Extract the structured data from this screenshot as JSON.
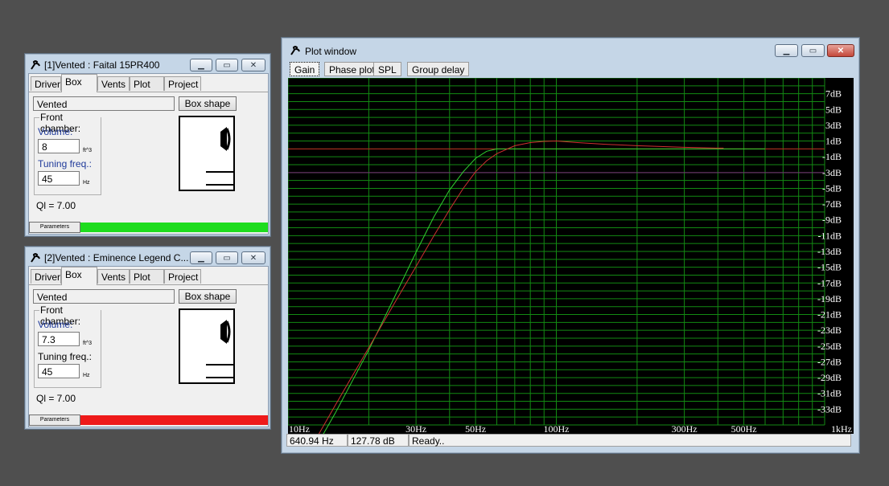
{
  "window1": {
    "title": "[1]Vented : Faital 15PR400",
    "tabs": [
      "Driver",
      "Box",
      "Vents",
      "Plot",
      "Project"
    ],
    "active_tab": "Box",
    "box_type": "Vented",
    "box_shape_button": "Box shape",
    "front_chamber_label": "Front chamber:",
    "volume_label": "Volume:",
    "volume_value": "8",
    "volume_unit": "ft^3",
    "tuning_label": "Tuning freq.:",
    "tuning_value": "45",
    "tuning_unit": "Hz",
    "ql_text": "Ql = 7.00",
    "parameters_button": "Parameters",
    "status_color": "#1edc1e"
  },
  "window2": {
    "title": "[2]Vented : Eminence Legend C...",
    "tabs": [
      "Driver",
      "Box",
      "Vents",
      "Plot",
      "Project"
    ],
    "active_tab": "Box",
    "box_type": "Vented",
    "box_shape_button": "Box shape",
    "front_chamber_label": "Front chamber:",
    "volume_label": "Volume:",
    "volume_value": "7.3",
    "volume_unit": "ft^3",
    "tuning_label": "Tuning freq.:",
    "tuning_value": "45",
    "tuning_unit": "Hz",
    "ql_text": "Ql = 7.00",
    "parameters_button": "Parameters",
    "status_color": "#ee1a1a"
  },
  "plot_window": {
    "title": "Plot window",
    "tabs": [
      "Gain",
      "Phase plot",
      "SPL",
      "Group delay"
    ],
    "active_tab": "Gain",
    "status": {
      "frequency": "640.94 Hz",
      "level": "127.78 dB",
      "message": "Ready.."
    }
  },
  "icons": {
    "app": "speaker-app-icon",
    "minimize": "minimize-icon",
    "maximize": "maximize-icon",
    "close": "close-icon"
  },
  "chart_data": {
    "type": "line",
    "x_scale": "log",
    "xlim": [
      10,
      1000
    ],
    "ylim": [
      -35,
      9
    ],
    "x_tick_labels": [
      "10Hz",
      "30Hz",
      "50Hz",
      "100Hz",
      "300Hz",
      "500Hz",
      "1kHz"
    ],
    "x_ticks": [
      10,
      30,
      50,
      100,
      300,
      500,
      1000
    ],
    "y_ticks": [
      7,
      5,
      3,
      1,
      -1,
      -3,
      -5,
      -7,
      -9,
      -11,
      -13,
      -15,
      -17,
      -19,
      -21,
      -23,
      -25,
      -27,
      -29,
      -31,
      -33
    ],
    "y_tick_suffix": "dB",
    "grid": true,
    "reference_lines": [
      {
        "y": 0,
        "color": "#c02020"
      },
      {
        "y": -3,
        "color": "#7a2a7a"
      }
    ],
    "series": [
      {
        "color": "#30d030",
        "x": [
          10,
          15,
          20,
          25,
          30,
          35,
          40,
          45,
          50,
          55,
          60,
          70,
          80,
          100,
          150,
          200,
          300,
          400,
          500,
          600
        ],
        "y": [
          -44,
          -33.5,
          -25.5,
          -18.7,
          -13.1,
          -8.6,
          -5.2,
          -2.9,
          -1.2,
          -0.3,
          0.0,
          0.0,
          0.0,
          0.0,
          0.0,
          0.0,
          0.0,
          0.0,
          0.0,
          0.0
        ]
      },
      {
        "color": "#d03030",
        "x": [
          10,
          15,
          20,
          25,
          30,
          35,
          40,
          45,
          50,
          55,
          60,
          70,
          80,
          90,
          100,
          120,
          150,
          200,
          300,
          400,
          420
        ],
        "y": [
          -43,
          -32.5,
          -25.2,
          -19.5,
          -14.9,
          -11.0,
          -7.7,
          -5.0,
          -2.9,
          -1.5,
          -0.6,
          0.4,
          0.8,
          0.95,
          1.0,
          0.8,
          0.6,
          0.4,
          0.2,
          0.1,
          0.1
        ]
      }
    ]
  }
}
